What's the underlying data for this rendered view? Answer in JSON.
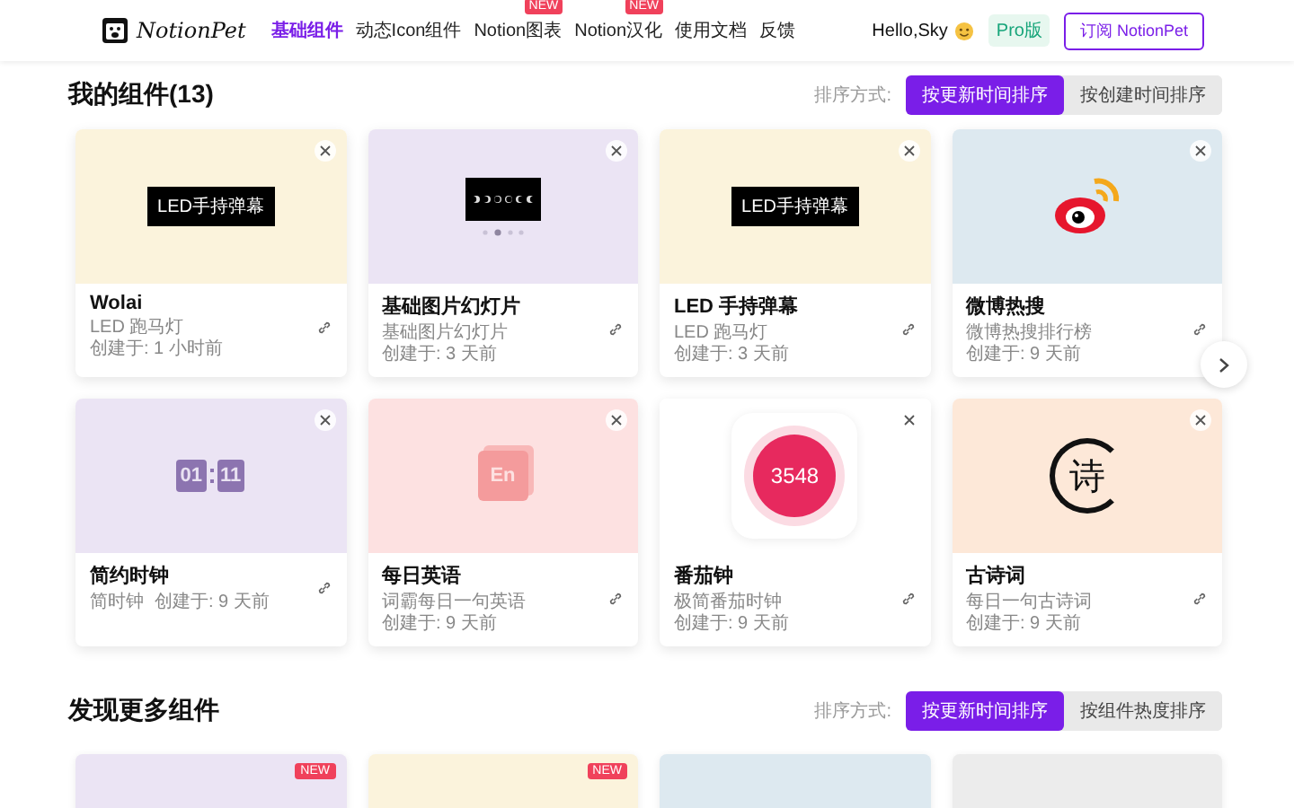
{
  "header": {
    "logo": "NotionPet",
    "nav": [
      {
        "label": "基础组件",
        "selected": true
      },
      {
        "label": "动态Icon组件",
        "selected": false
      },
      {
        "label": "Notion图表",
        "selected": false,
        "badge": "NEW"
      },
      {
        "label": "Notion汉化",
        "selected": false,
        "badge": "NEW"
      },
      {
        "label": "使用文档",
        "selected": false
      },
      {
        "label": "反馈",
        "selected": false
      }
    ],
    "greeting": "Hello,Sky",
    "plan": "Pro版",
    "subscribe": "订阅 NotionPet"
  },
  "my_widgets": {
    "title": "我的组件(13)",
    "sort_label": "排序方式:",
    "sort_options": [
      {
        "label": "按更新时间排序",
        "selected": true
      },
      {
        "label": "按创建时间排序",
        "selected": false
      }
    ],
    "cards": [
      {
        "title": "Wolai",
        "desc": "LED 跑马灯",
        "created": "创建于: 1 小时前",
        "color": "#fbf3dc",
        "preview": {
          "kind": "led",
          "text": "LED手持弹幕"
        }
      },
      {
        "title": "基础图片幻灯片",
        "desc": "基础图片幻灯片",
        "created": "创建于: 3 天前",
        "color": "#ebe4f4",
        "preview": {
          "kind": "slides"
        }
      },
      {
        "title": "LED 手持弹幕",
        "desc": "LED 跑马灯",
        "created": "创建于: 3 天前",
        "color": "#fbf3dc",
        "preview": {
          "kind": "led",
          "text": "LED手持弹幕"
        }
      },
      {
        "title": "微博热搜",
        "desc": "微博热搜排行榜",
        "created": "创建于: 9 天前",
        "color": "#dde9f0",
        "preview": {
          "kind": "weibo"
        }
      },
      {
        "title": "简约时钟",
        "desc": "简时钟",
        "created": "创建于: 9 天前",
        "color": "#ebe4f4",
        "preview": {
          "kind": "clock",
          "hours": "01",
          "minutes": "11"
        }
      },
      {
        "title": "每日英语",
        "desc": "词霸每日一句英语",
        "created": "创建于: 9 天前",
        "color": "#fde1e1",
        "preview": {
          "kind": "english",
          "text": "En"
        }
      },
      {
        "title": "番茄钟",
        "desc": "极简番茄时钟",
        "created": "创建于: 9 天前",
        "color": "#ffffff",
        "preview": {
          "kind": "pomodoro",
          "text": "3548"
        }
      },
      {
        "title": "古诗词",
        "desc": "每日一句古诗词",
        "created": "创建于: 9 天前",
        "color": "#fde8d8",
        "preview": {
          "kind": "poem",
          "text": "诗"
        }
      }
    ]
  },
  "discover": {
    "title": "发现更多组件",
    "sort_label": "排序方式:",
    "sort_options": [
      {
        "label": "按更新时间排序",
        "selected": true
      },
      {
        "label": "按组件热度排序",
        "selected": false
      }
    ],
    "cards": [
      {
        "color": "#ebe4f4",
        "badge": "NEW"
      },
      {
        "color": "#fbf3dc",
        "badge": "NEW"
      },
      {
        "color": "#dde9f0"
      },
      {
        "color": "#ececec"
      }
    ]
  }
}
